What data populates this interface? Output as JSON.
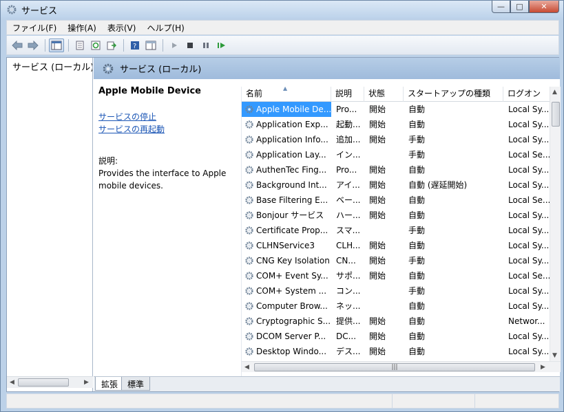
{
  "window": {
    "title": "サービス",
    "minimize": "—",
    "maximize": "□",
    "close": "✕"
  },
  "menu": [
    "ファイル(F)",
    "操作(A)",
    "表示(V)",
    "ヘルプ(H)"
  ],
  "tree": {
    "root_label": "サービス (ローカル)"
  },
  "header": {
    "title": "サービス (ローカル)"
  },
  "details": {
    "service_name": "Apple Mobile Device",
    "link_stop": "サービスの停止",
    "link_restart": "サービスの再起動",
    "desc_label": "説明:",
    "desc_text": "Provides the interface to Apple mobile devices."
  },
  "columns": [
    "名前",
    "説明",
    "状態",
    "スタートアップの種類",
    "ログオン"
  ],
  "rows": [
    {
      "name": "Apple Mobile De...",
      "desc": "Pro...",
      "status": "開始",
      "startup": "自動",
      "logon": "Local Sy...",
      "selected": true
    },
    {
      "name": "Application Exp...",
      "desc": "起動...",
      "status": "開始",
      "startup": "自動",
      "logon": "Local Sy..."
    },
    {
      "name": "Application Info...",
      "desc": "追加...",
      "status": "開始",
      "startup": "手動",
      "logon": "Local Sy..."
    },
    {
      "name": "Application Lay...",
      "desc": "イン...",
      "status": "",
      "startup": "手動",
      "logon": "Local Se..."
    },
    {
      "name": "AuthenTec Fing...",
      "desc": "Pro...",
      "status": "開始",
      "startup": "自動",
      "logon": "Local Sy..."
    },
    {
      "name": "Background Int...",
      "desc": "アイ...",
      "status": "開始",
      "startup": "自動 (遅延開始)",
      "logon": "Local Sy..."
    },
    {
      "name": "Base Filtering E...",
      "desc": "ベー...",
      "status": "開始",
      "startup": "自動",
      "logon": "Local Se..."
    },
    {
      "name": "Bonjour サービス",
      "desc": "ハー...",
      "status": "開始",
      "startup": "自動",
      "logon": "Local Sy..."
    },
    {
      "name": "Certificate Prop...",
      "desc": "スマ...",
      "status": "",
      "startup": "手動",
      "logon": "Local Sy..."
    },
    {
      "name": "CLHNService3",
      "desc": "CLH...",
      "status": "開始",
      "startup": "自動",
      "logon": "Local Sy..."
    },
    {
      "name": "CNG Key Isolation",
      "desc": "CN...",
      "status": "開始",
      "startup": "手動",
      "logon": "Local Sy..."
    },
    {
      "name": "COM+ Event Sy...",
      "desc": "サポ...",
      "status": "開始",
      "startup": "自動",
      "logon": "Local Se..."
    },
    {
      "name": "COM+ System ...",
      "desc": "コン...",
      "status": "",
      "startup": "手動",
      "logon": "Local Sy..."
    },
    {
      "name": "Computer Brow...",
      "desc": "ネッ...",
      "status": "",
      "startup": "自動",
      "logon": "Local Sy..."
    },
    {
      "name": "Cryptographic S...",
      "desc": "提供...",
      "status": "開始",
      "startup": "自動",
      "logon": "Networ..."
    },
    {
      "name": "DCOM Server P...",
      "desc": "DC...",
      "status": "開始",
      "startup": "自動",
      "logon": "Local Sy..."
    },
    {
      "name": "Desktop Windo...",
      "desc": "デス...",
      "status": "開始",
      "startup": "自動",
      "logon": "Local Sy..."
    }
  ],
  "tabs": [
    "拡張",
    "標準"
  ]
}
